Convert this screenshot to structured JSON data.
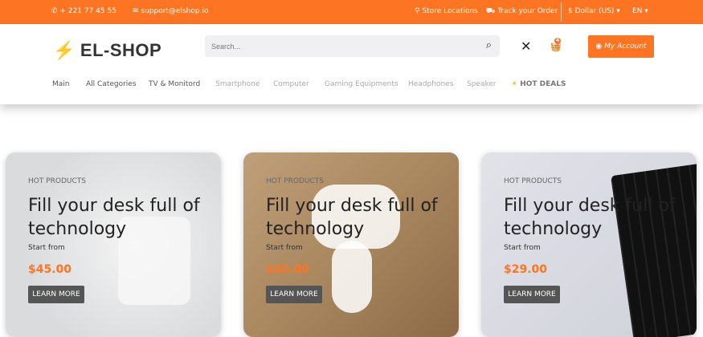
{
  "topbar": {
    "phone": "+ 221 77 45 55",
    "email": "support@elshop.io",
    "store_locations": "Store Locations",
    "track_order": "Track your Order",
    "currency": "$ Dollar (US)",
    "language": "EN"
  },
  "header": {
    "logo": "EL-SHOP",
    "search_placeholder": "Search...",
    "cart_count": "4",
    "account": "My Account"
  },
  "nav": [
    "Main",
    "All Categories",
    "TV & Monitord",
    "Smartphone",
    "Computer",
    "Gaming Equipments",
    "Headphones",
    "Speaker",
    "HOT DEALS"
  ],
  "cards": [
    {
      "kicker": "HOT PRODUCTS",
      "title": "Fill your desk full of technology",
      "start": "Start from",
      "price": "$45.00",
      "button": "LEARN MORE"
    },
    {
      "kicker": "HOT PRODUCTS",
      "title": "Fill your desk full of technology",
      "start": "Start from",
      "price": "$80.00",
      "button": "LEARN MORE"
    },
    {
      "kicker": "HOT PRODUCTS",
      "title": "Fill your desk full of technology",
      "start": "Start from",
      "price": "$29.00",
      "button": "LEARN MORE"
    }
  ]
}
